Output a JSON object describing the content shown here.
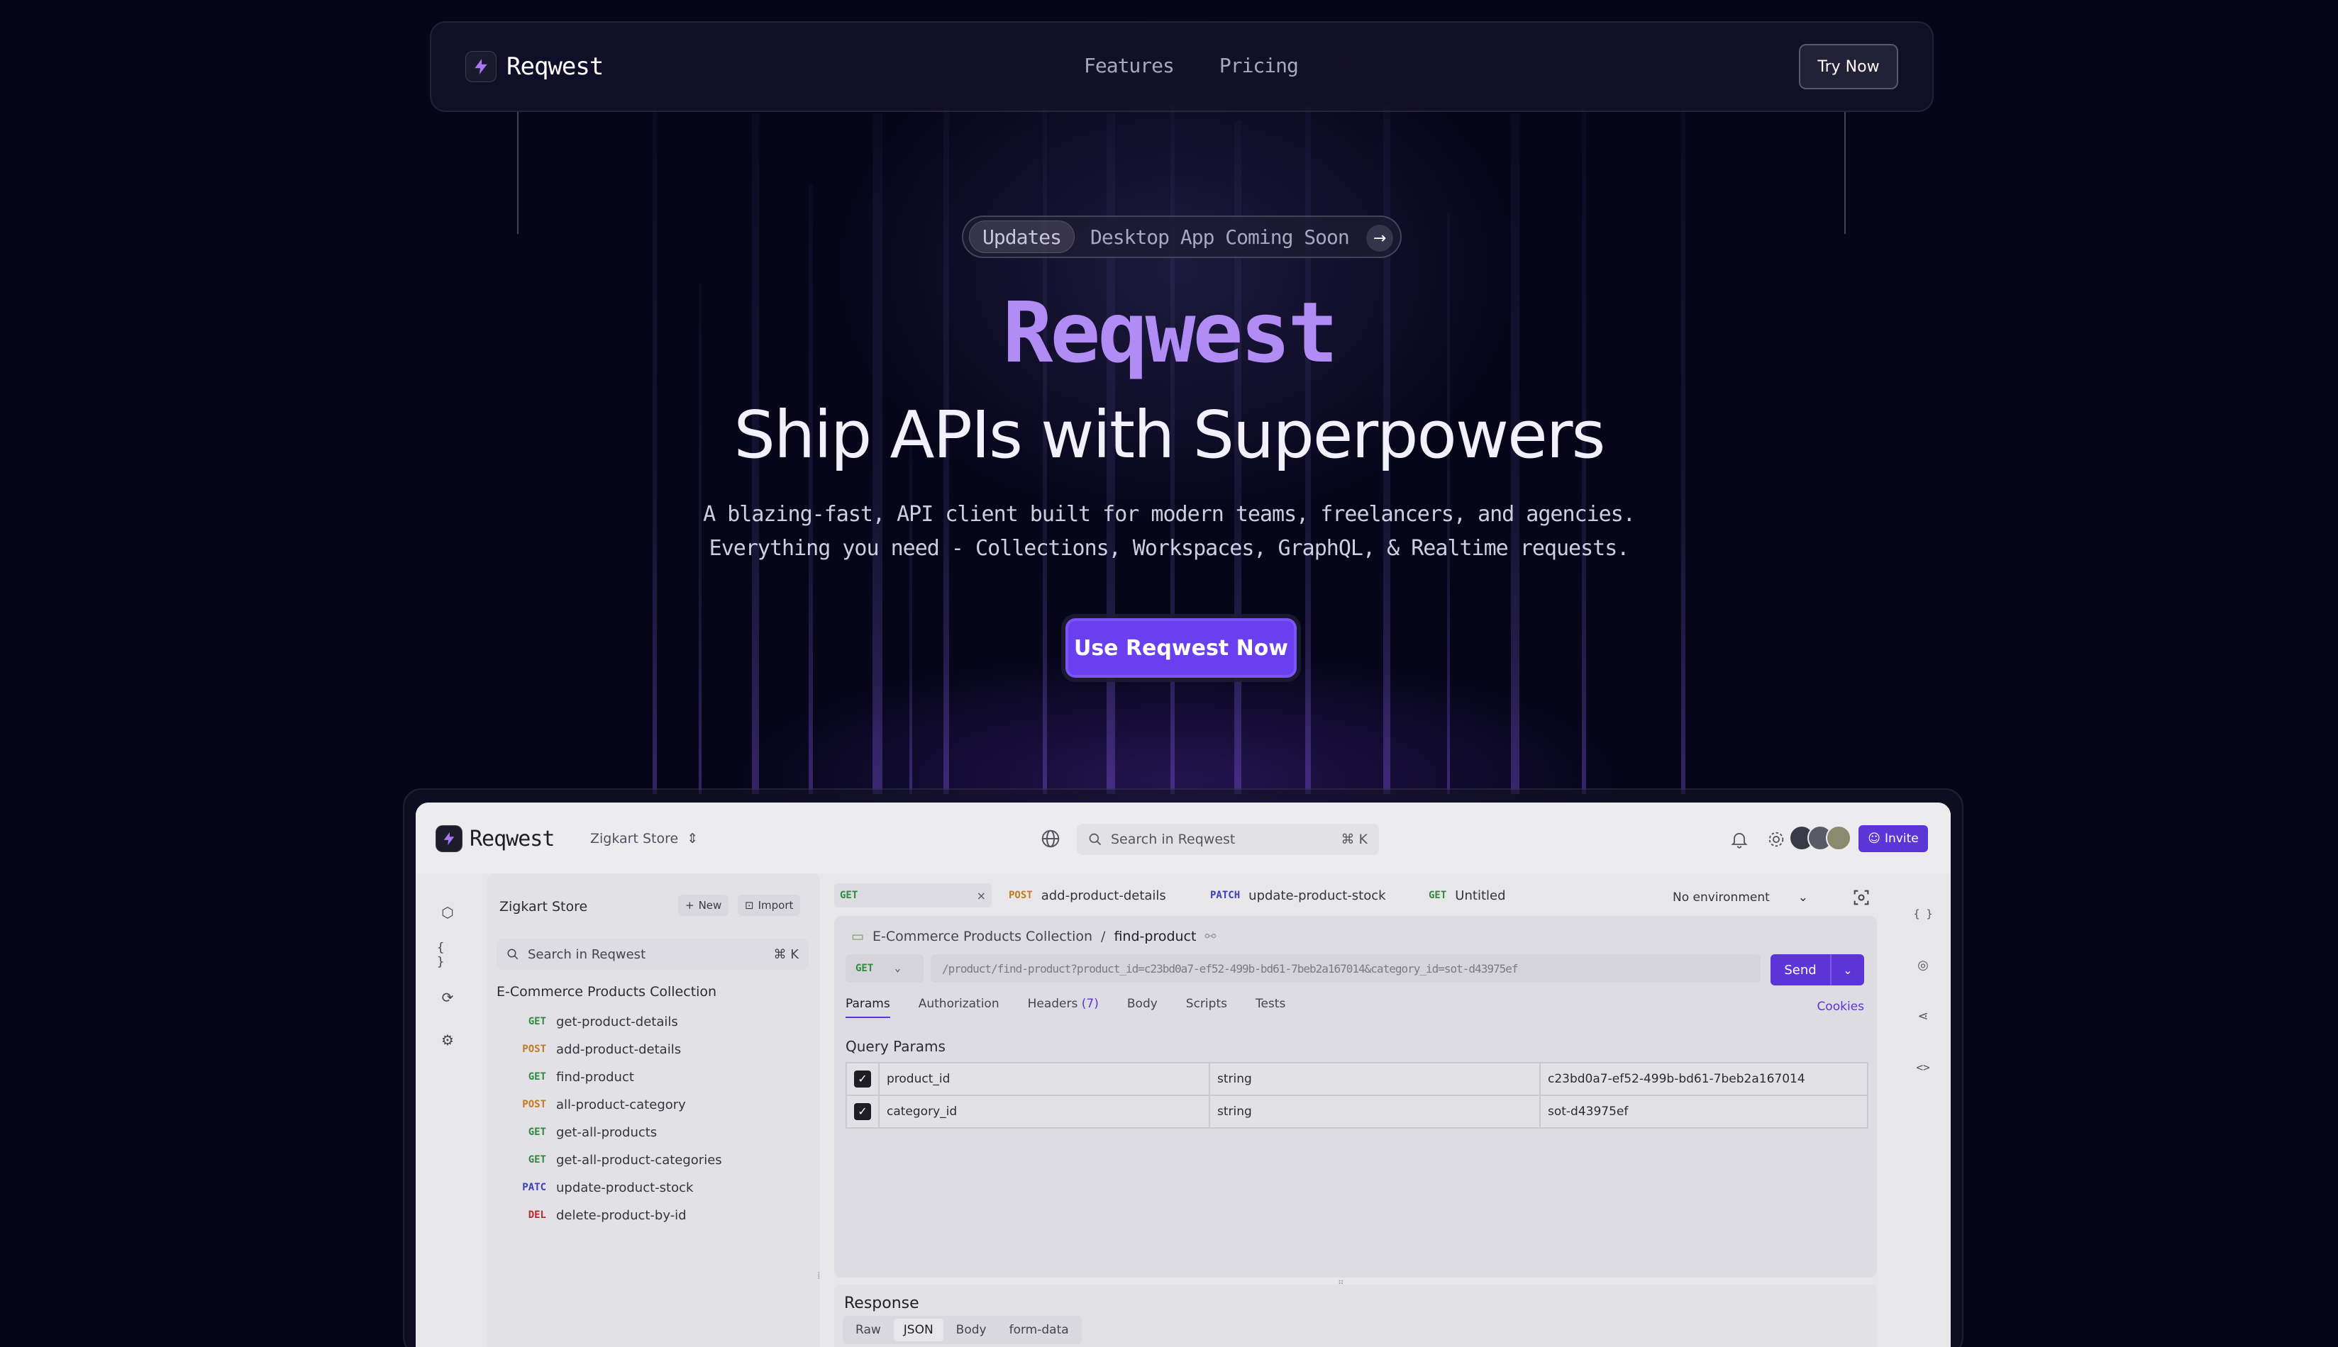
{
  "nav": {
    "brand": "Reqwest",
    "links": [
      "Features",
      "Pricing"
    ],
    "cta": "Try Now"
  },
  "hero": {
    "pill_tag": "Updates",
    "pill_text": "Desktop App Coming Soon",
    "brand": "Reqwest",
    "title": "Ship APIs with Superpowers",
    "sub_line1": "A blazing-fast, API client built for modern teams, freelancers, and agencies.",
    "sub_line2": "Everything you need - Collections, Workspaces, GraphQL, & Realtime requests.",
    "cta": "Use Reqwest Now"
  },
  "app": {
    "brand": "Reqwest",
    "workspace": "Zigkart Store",
    "search_placeholder": "Search in Reqwest",
    "search_kbd": "⌘ K",
    "invite": "Invite",
    "sidebar": {
      "title": "Zigkart Store",
      "new_btn": "New",
      "import_btn": "Import",
      "search_placeholder": "Search in Reqwest",
      "search_kbd": "⌘ K",
      "collection": "E-Commerce Products Collection",
      "items": [
        {
          "method": "GET",
          "name": "get-product-details"
        },
        {
          "method": "POST",
          "name": "add-product-details"
        },
        {
          "method": "GET",
          "name": "find-product"
        },
        {
          "method": "POST",
          "name": "all-product-category"
        },
        {
          "method": "GET",
          "name": "get-all-products"
        },
        {
          "method": "GET",
          "name": "get-all-product-categories"
        },
        {
          "method": "PATC",
          "name": "update-product-stock"
        },
        {
          "method": "DEL",
          "name": "delete-product-by-id"
        }
      ]
    },
    "tabs": [
      {
        "method": "GET",
        "name": "",
        "close": "×"
      },
      {
        "method": "POST",
        "name": "add-product-details"
      },
      {
        "method": "PATCH",
        "name": "update-product-stock"
      },
      {
        "method": "GET",
        "name": "Untitled"
      }
    ],
    "environment": "No environment",
    "breadcrumb": {
      "collection": "E-Commerce Products Collection",
      "sep": "/",
      "request": "find-product"
    },
    "request": {
      "method": "GET",
      "url": "/product/find-product?product_id=c23bd0a7-ef52-499b-bd61-7beb2a167014&category_id=sot-d43975ef",
      "send": "Send"
    },
    "req_tabs": {
      "params": "Params",
      "authorization": "Authorization",
      "headers": "Headers",
      "headers_count": "(7)",
      "body": "Body",
      "scripts": "Scripts",
      "tests": "Tests",
      "cookies": "Cookies"
    },
    "query_params": {
      "title": "Query Params",
      "rows": [
        {
          "checked": "✓",
          "key": "product_id",
          "type": "string",
          "value": "c23bd0a7-ef52-499b-bd61-7beb2a167014"
        },
        {
          "checked": "✓",
          "key": "category_id",
          "type": "string",
          "value": "sot-d43975ef"
        }
      ]
    },
    "response": {
      "title": "Response",
      "tabs": [
        "Raw",
        "JSON",
        "Body",
        "form-data"
      ]
    }
  },
  "colors": {
    "accent": "#5b35d5",
    "brand_gradient": "#b08cf4",
    "get": "#2f8a3e",
    "post": "#c07a22",
    "patch": "#3d3fb6",
    "delete": "#b52b2b"
  }
}
